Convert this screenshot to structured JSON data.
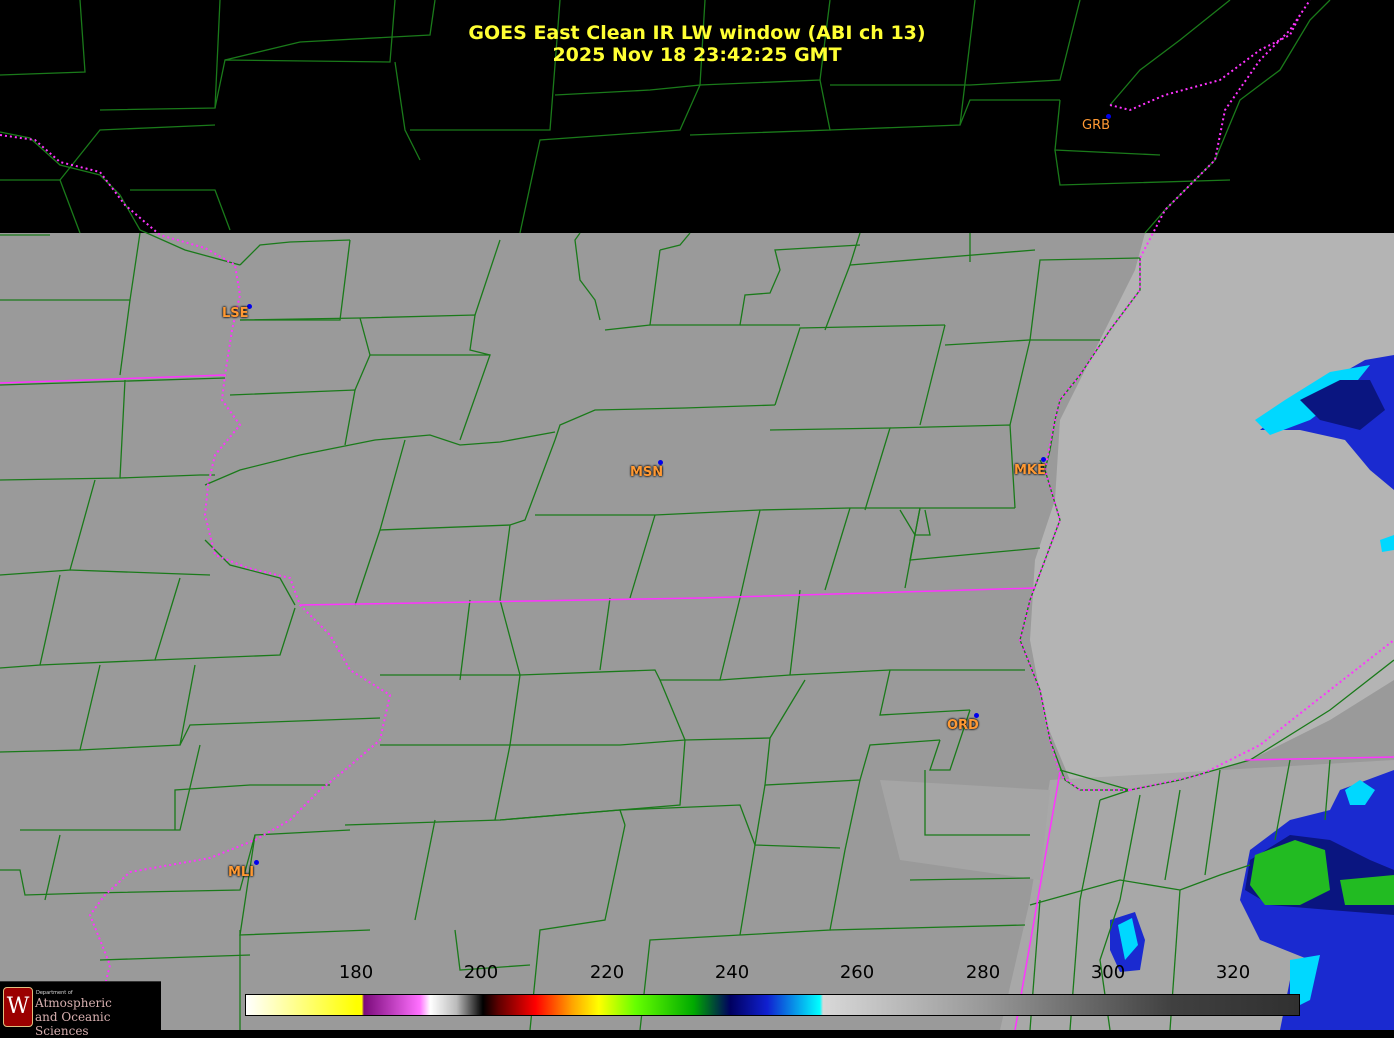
{
  "title": {
    "line1": "GOES East Clean IR LW window (ABI ch 13)",
    "line2": "2025 Nov 18  23:42:25 GMT"
  },
  "cities": [
    {
      "code": "GRB",
      "color": "#ff9933"
    },
    {
      "code": "LSE",
      "color": "#ff9933"
    },
    {
      "code": "MSN",
      "color": "#ff9933"
    },
    {
      "code": "MKE",
      "color": "#ff9933"
    },
    {
      "code": "ORD",
      "color": "#ff9933"
    },
    {
      "code": "MLI",
      "color": "#ff9933"
    }
  ],
  "colorbar": {
    "ticks": [
      "180",
      "200",
      "220",
      "240",
      "260",
      "280",
      "300",
      "320"
    ]
  },
  "logo": {
    "dept": "Department of",
    "line1": "Atmospheric",
    "line2": "and Oceanic Sciences"
  },
  "colors": {
    "title": "#ffff33",
    "county_lines": "#1a7a1a",
    "state_lines": "#ff33ff",
    "clear_sky": "#9a9a9a",
    "no_data": "#000000"
  }
}
